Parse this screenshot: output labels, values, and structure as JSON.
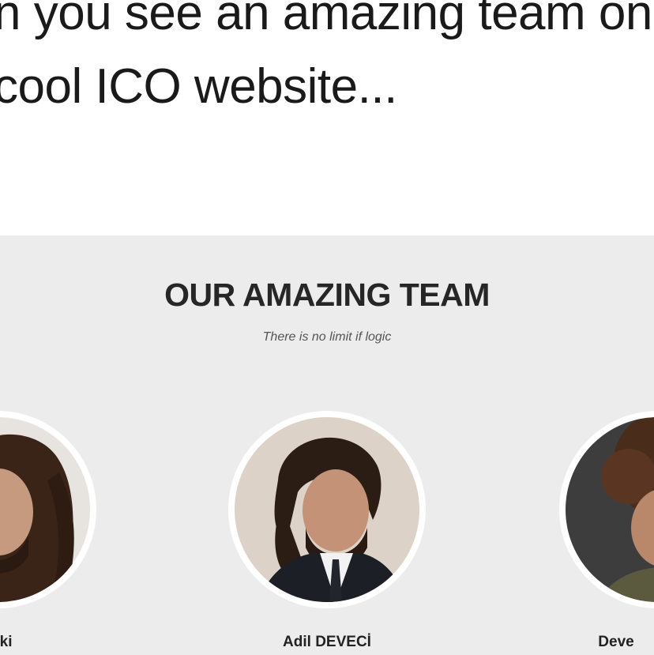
{
  "caption": {
    "line1": "n you see an amazing team on t",
    "line2": "cool ICO website..."
  },
  "screenshot": {
    "title": "OUR AMAZING TEAM",
    "subtitle": "There is no limit if logic",
    "members": [
      {
        "name": "vski"
      },
      {
        "name": "Adil DEVECİ"
      },
      {
        "name": "Deve"
      }
    ]
  },
  "colors": {
    "section_bg": "#ececec",
    "title_text": "#262626"
  },
  "icons": [
    "person-photo-left",
    "person-photo-center",
    "person-photo-right"
  ]
}
